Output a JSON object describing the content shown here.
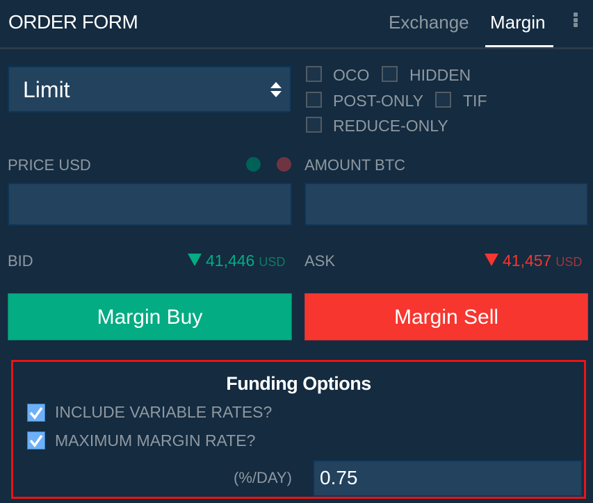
{
  "header": {
    "title": "ORDER FORM",
    "tabs": [
      {
        "label": "Exchange",
        "active": false
      },
      {
        "label": "Margin",
        "active": true
      }
    ],
    "menu_icon": "more-vertical-icon"
  },
  "order_type": {
    "selected": "Limit",
    "icon": "select-arrows-icon"
  },
  "options": [
    {
      "label": "OCO",
      "checked": false
    },
    {
      "label": "HIDDEN",
      "checked": false
    },
    {
      "label": "POST-ONLY",
      "checked": false
    },
    {
      "label": "TIF",
      "checked": false
    },
    {
      "label": "REDUCE-ONLY",
      "checked": false
    }
  ],
  "price": {
    "label": "PRICE USD",
    "value": "",
    "indicator_colors": [
      "#006157",
      "#6e3540"
    ]
  },
  "amount": {
    "label": "AMOUNT BTC",
    "value": ""
  },
  "bid": {
    "label": "BID",
    "value": "41,446",
    "unit": "USD",
    "direction": "down",
    "color": "#03ac83"
  },
  "ask": {
    "label": "ASK",
    "value": "41,457",
    "unit": "USD",
    "direction": "down",
    "color": "#f6362f"
  },
  "actions": {
    "buy_label": "Margin Buy",
    "sell_label": "Margin Sell",
    "buy_color": "#03ac83",
    "sell_color": "#f6362f"
  },
  "funding": {
    "title": "Funding Options",
    "include_variable_rates": {
      "label": "INCLUDE VARIABLE RATES?",
      "checked": true
    },
    "maximum_margin_rate": {
      "label": "MAXIMUM MARGIN RATE?",
      "checked": true
    },
    "rate_unit_label": "(%/DAY)",
    "rate_value": "0.75"
  }
}
